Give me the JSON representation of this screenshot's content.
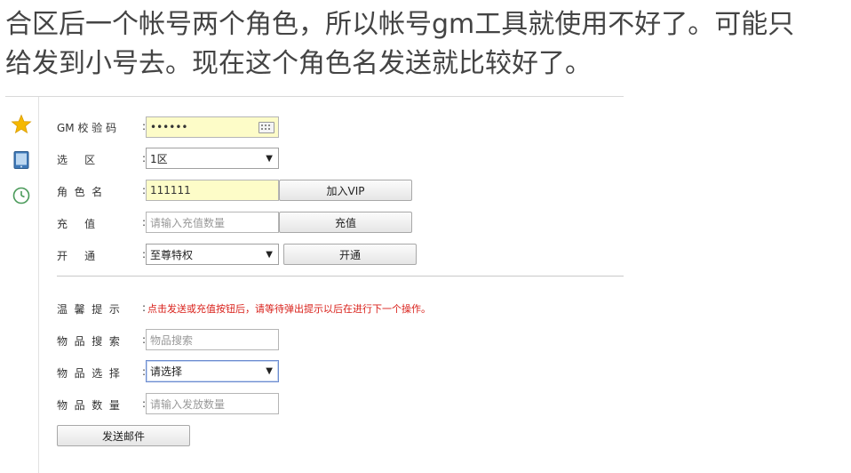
{
  "intro": {
    "line1": "合区后一个帐号两个角色，所以帐号gm工具就使用不好了。可能只",
    "line2": "给发到小号去。现在这个角色名发送就比较好了。"
  },
  "sidebar": {
    "icons": [
      "star-icon",
      "tablet-icon",
      "clock-icon"
    ]
  },
  "form": {
    "gm_code": {
      "label": "GM 校 验 码",
      "value": "••••••"
    },
    "zone": {
      "label": "选     区",
      "selected": "1区"
    },
    "role": {
      "label": "角  色  名",
      "value": "111111",
      "button": "加入VIP"
    },
    "recharge": {
      "label": "充     值",
      "placeholder": "请输入充值数量",
      "button": "充值"
    },
    "open": {
      "label": "开     通",
      "selected": "至尊特权",
      "button": "开通"
    }
  },
  "mail": {
    "tip": {
      "label": "温  馨  提  示",
      "text": "点击发送或充值按钮后，请等待弹出提示以后在进行下一个操作。"
    },
    "search": {
      "label": "物  品  搜  索",
      "placeholder": "物品搜索"
    },
    "select": {
      "label": "物  品  选  择",
      "selected": "请选择"
    },
    "quantity": {
      "label": "物  品  数  量",
      "placeholder": "请输入发放数量"
    },
    "send_button": "发送邮件"
  },
  "colors": {
    "autofill_bg": "#fdfcc8",
    "tip_red": "#d9211b",
    "star": "#f5b800"
  }
}
